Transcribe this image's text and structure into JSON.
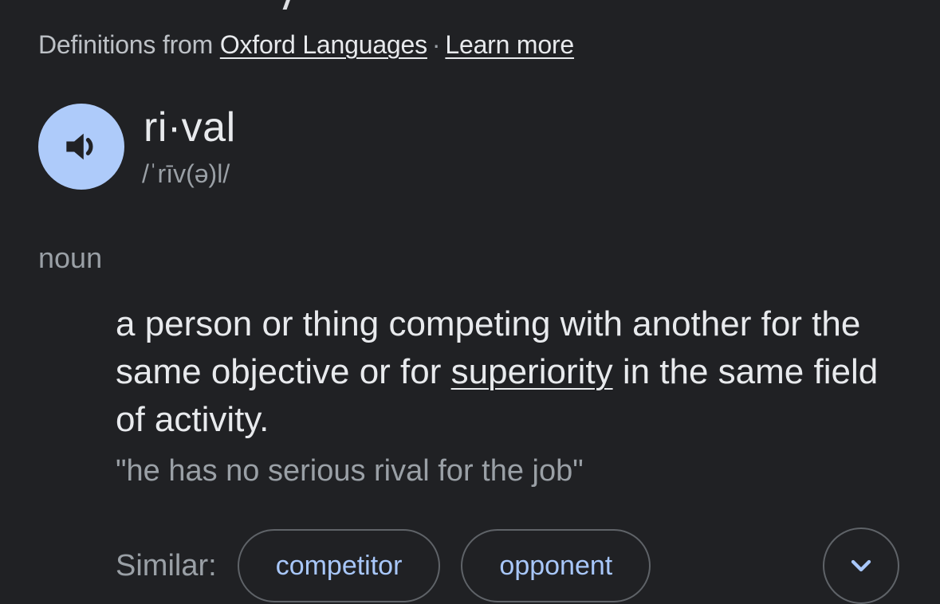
{
  "source": {
    "prefix": "Definitions from",
    "provider_link": "Oxford Languages",
    "separator": "·",
    "learn_more": "Learn more"
  },
  "entry": {
    "headword": "ri·val",
    "pronunciation": "/ˈrīv(ə)l/",
    "audio_icon": "speaker-icon",
    "part_of_speech": "noun"
  },
  "definition": {
    "text_before": "a person or thing competing with another for the same objective or for ",
    "linked_word": "superiority",
    "text_after": " in the same field of activity.",
    "example": "\"he has no serious rival for the job\""
  },
  "similar": {
    "label": "Similar:",
    "chips": [
      "competitor",
      "opponent"
    ],
    "expand_icon": "chevron-down-icon"
  },
  "colors": {
    "background": "#202124",
    "text_primary": "#e8eaed",
    "text_secondary": "#9aa0a6",
    "accent_chip_text": "#a8c7fa",
    "audio_button_bg": "#aecbfa"
  }
}
